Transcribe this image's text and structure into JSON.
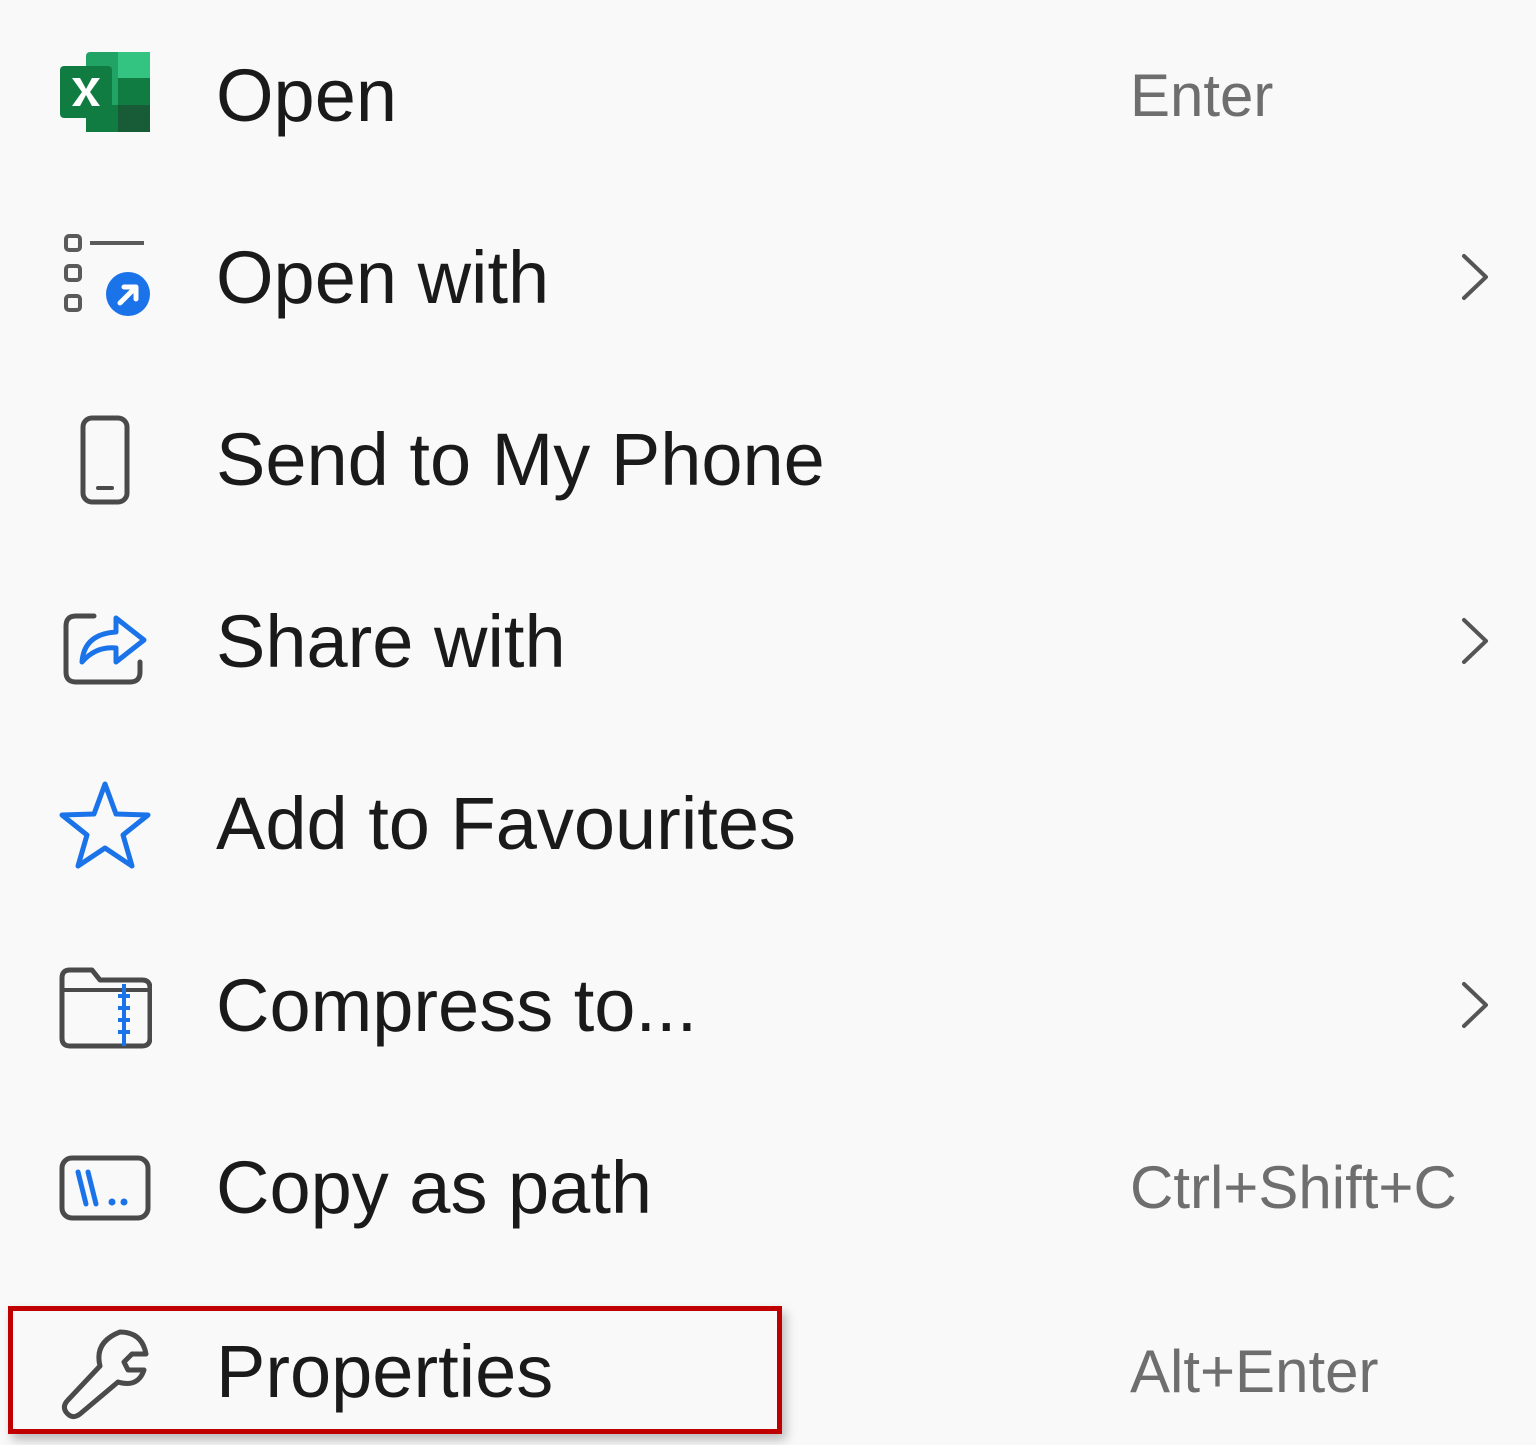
{
  "menu": {
    "items": [
      {
        "label": "Open",
        "shortcut": "Enter",
        "icon": "excel-icon",
        "has_submenu": false
      },
      {
        "label": "Open with",
        "shortcut": "",
        "icon": "open-with-icon",
        "has_submenu": true
      },
      {
        "label": "Send to My Phone",
        "shortcut": "",
        "icon": "phone-icon",
        "has_submenu": false
      },
      {
        "label": "Share with",
        "shortcut": "",
        "icon": "share-icon",
        "has_submenu": true
      },
      {
        "label": "Add to Favourites",
        "shortcut": "",
        "icon": "star-icon",
        "has_submenu": false
      },
      {
        "label": "Compress to...",
        "shortcut": "",
        "icon": "zip-folder-icon",
        "has_submenu": true
      },
      {
        "label": "Copy as path",
        "shortcut": "Ctrl+Shift+C",
        "icon": "copy-path-icon",
        "has_submenu": false
      },
      {
        "label": "Properties",
        "shortcut": "Alt+Enter",
        "icon": "wrench-icon",
        "has_submenu": false,
        "highlighted": true
      }
    ]
  },
  "colors": {
    "background": "#f9f9f9",
    "text": "#1a1a1a",
    "shortcut_text": "#6e6e6e",
    "accent_blue": "#1a73e8",
    "excel_green": "#107c41",
    "highlight_red": "#c00000"
  }
}
